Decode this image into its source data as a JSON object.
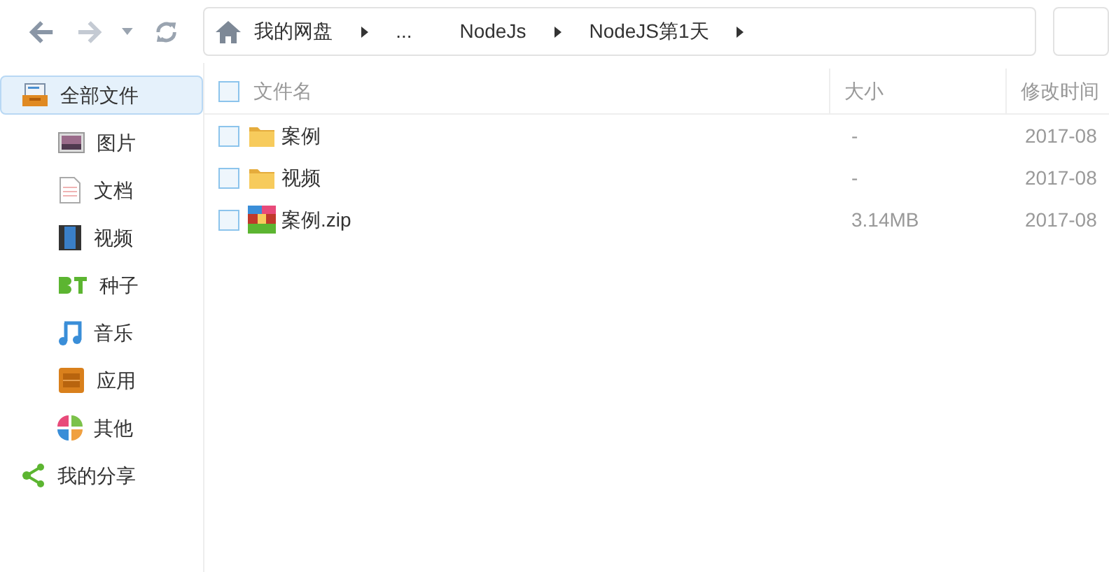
{
  "breadcrumb": [
    {
      "label": "我的网盘"
    },
    {
      "label": "..."
    },
    {
      "label": "NodeJs"
    },
    {
      "label": "NodeJS第1天"
    }
  ],
  "sidebar": {
    "items": [
      {
        "label": "全部文件",
        "selected": true,
        "children": [
          {
            "label": "图片",
            "selected": false
          },
          {
            "label": "文档",
            "selected": false
          },
          {
            "label": "视频",
            "selected": false
          },
          {
            "label": "种子",
            "selected": false
          },
          {
            "label": "音乐",
            "selected": false
          },
          {
            "label": "应用",
            "selected": false
          },
          {
            "label": "其他",
            "selected": false
          }
        ]
      },
      {
        "label": "我的分享",
        "selected": false
      }
    ]
  },
  "table": {
    "columns": [
      "文件名",
      "大小",
      "修改时间"
    ],
    "all_checked": false,
    "rows": [
      {
        "kind": "folder",
        "name": "案例",
        "size": "-",
        "modified": "2017-08",
        "checked": false
      },
      {
        "kind": "folder",
        "name": "视频",
        "size": "-",
        "modified": "2017-08",
        "checked": false
      },
      {
        "kind": "zip",
        "name": "案例.zip",
        "size": "3.14MB",
        "modified": "2017-08",
        "checked": false
      }
    ]
  }
}
